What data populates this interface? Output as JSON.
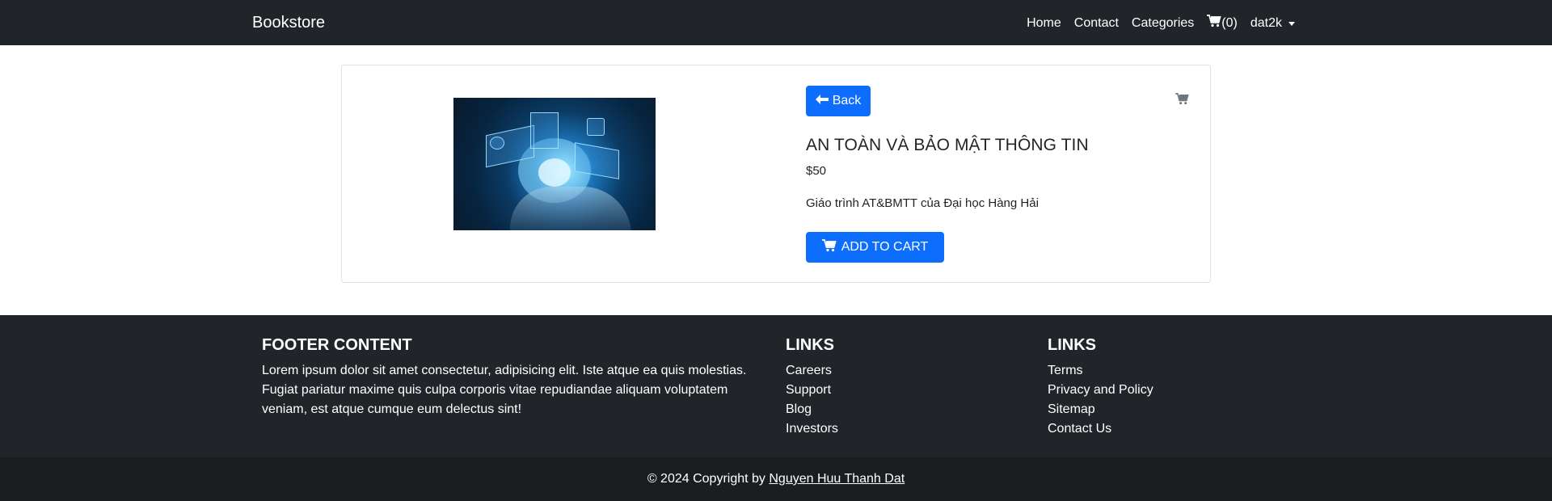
{
  "navbar": {
    "brand": "Bookstore",
    "links": [
      "Home",
      "Contact",
      "Categories"
    ],
    "cart_count": "(0)",
    "user": "dat2k"
  },
  "product": {
    "back_label": "Back",
    "title": "AN TOÀN VÀ BẢO MẬT THÔNG TIN",
    "price": "$50",
    "description": "Giáo trình AT&BMTT của Đại học Hàng Hải",
    "add_to_cart_label": "ADD TO CART",
    "image_icon": "cloud-technology-image"
  },
  "footer": {
    "content_title": "FOOTER CONTENT",
    "content_text": "Lorem ipsum dolor sit amet consectetur, adipisicing elit. Iste atque ea quis molestias. Fugiat pariatur maxime quis culpa corporis vitae repudiandae aliquam voluptatem veniam, est atque cumque eum delectus sint!",
    "links1_title": "LINKS",
    "links1": [
      "Careers",
      "Support",
      "Blog",
      "Investors"
    ],
    "links2_title": "LINKS",
    "links2": [
      "Terms",
      "Privacy and Policy",
      "Sitemap",
      "Contact Us"
    ]
  },
  "copyright": {
    "prefix": "© 2024 Copyright by ",
    "author": "Nguyen Huu Thanh Dat"
  },
  "colors": {
    "navbar_bg": "#212529",
    "primary": "#0d6efd",
    "footer_bg": "#212529",
    "copyright_bg": "#1b1e21"
  }
}
